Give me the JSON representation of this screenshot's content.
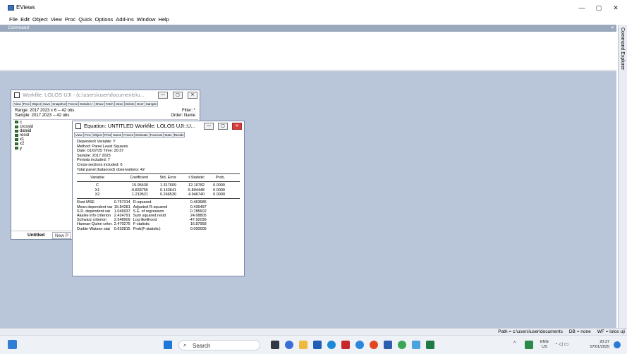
{
  "app": {
    "title": "EViews"
  },
  "window_controls": {
    "minimize": "—",
    "maximize": "▢",
    "close": "✕"
  },
  "menu": [
    "File",
    "Edit",
    "Object",
    "View",
    "Proc",
    "Quick",
    "Options",
    "Add-ins",
    "Window",
    "Help"
  ],
  "command": {
    "label": "Command",
    "close": "✕"
  },
  "explorer": {
    "label": "Command Explorer"
  },
  "status": {
    "path": "Path = c:\\users\\user\\documents",
    "db": "DB = none",
    "wf": "WF = lolos uji"
  },
  "workfile": {
    "title": "Workfile: LOLOS UJI - (c:\\users\\user\\documents\\u...",
    "toolbar": [
      "View",
      "Proc",
      "Object",
      "Save",
      "Snapshot",
      "Freeze",
      "Details+/-",
      "Show",
      "Fetch",
      "Store",
      "Delete",
      "Genr",
      "Sample"
    ],
    "range": "Range:  2017 2023 x 6   --  42 obs",
    "sample": "Sample: 2017 2023   --  42 obs",
    "filter": "Filter: *",
    "order": "Order: Name",
    "objects": [
      "c",
      "crossid",
      "dateid",
      "resid",
      "x1",
      "x2",
      "y"
    ],
    "tabs": {
      "active": "Untitled",
      "new": "New P"
    }
  },
  "equation": {
    "title": "Equation: UNTITLED   Workfile: LOLOS UJI::U...",
    "toolbar": [
      "View",
      "Proc",
      "Object",
      "Print",
      "Name",
      "Freeze",
      "Estimate",
      "Forecast",
      "Stats",
      "Resids"
    ],
    "header": [
      "Dependent Variable: Y",
      "Method: Panel Least Squares",
      "Date: 01/07/25   Time: 20:37",
      "Sample: 2017 2023",
      "Periods included: 7",
      "Cross-sections included: 6",
      "Total panel (balanced) observations: 42"
    ],
    "coef_header": [
      "Variable",
      "Coefficient",
      "Std. Error",
      "t-Statistic",
      "Prob."
    ],
    "coef_rows": [
      [
        "C",
        "15.95430",
        "1.317609",
        "12.10782",
        "0.0000"
      ],
      [
        "X1",
        "-0.833755",
        "0.143641",
        "-5.804448",
        "0.0000"
      ],
      [
        "X2",
        "1.219521",
        "0.246530",
        "4.946740",
        "0.0000"
      ]
    ],
    "stats_rows": [
      [
        "Root MSE",
        "0.757314",
        "R-squared",
        "0.463685"
      ],
      [
        "Mean dependent var",
        "15.84281",
        "Adjusted R-squared",
        "0.436497"
      ],
      [
        "S.D. dependent var",
        "1.046937",
        "S.E. of regression",
        "0.785602"
      ],
      [
        "Akaike info criterion",
        "2.424791",
        "Sum squared resid",
        "24.08805"
      ],
      [
        "Schwarz criterion",
        "2.548909",
        "Log likelihood",
        "-47.92039"
      ],
      [
        "Hannan-Quinn criter.",
        "2.470275",
        "F-statistic",
        "16.87958"
      ],
      [
        "Durbin-Watson stat",
        "0.632815",
        "Prob(F-statistic)",
        "0.000005"
      ]
    ]
  },
  "taskbar": {
    "search": "Search",
    "lang_top": "ENG",
    "lang_bottom": "US",
    "time": "20:37",
    "date": "07/01/2025"
  }
}
